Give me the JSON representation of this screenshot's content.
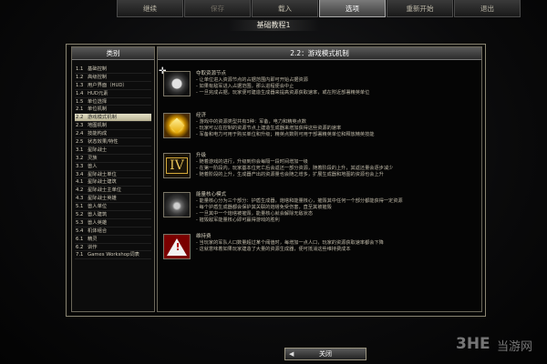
{
  "top_menu": {
    "tabs": [
      {
        "label": "继续",
        "state": "normal"
      },
      {
        "label": "保存",
        "state": "dim"
      },
      {
        "label": "载入",
        "state": "normal"
      },
      {
        "label": "选项",
        "state": "active"
      },
      {
        "label": "重新开始",
        "state": "normal"
      },
      {
        "label": "退出",
        "state": "normal"
      }
    ]
  },
  "page_title": "基础教程1",
  "left_panel": {
    "header": "类别",
    "selected_index": 6,
    "items": [
      {
        "num": "1.1",
        "label": "基础控制"
      },
      {
        "num": "1.2",
        "label": "高级控制"
      },
      {
        "num": "1.3",
        "label": "用户界面（HUD）"
      },
      {
        "num": "1.4",
        "label": "HUD元素"
      },
      {
        "num": "1.5",
        "label": "单位选择"
      },
      {
        "num": "2.1",
        "label": "单位机制"
      },
      {
        "num": "2.2",
        "label": "游戏模式机制"
      },
      {
        "num": "2.3",
        "label": "地图机制"
      },
      {
        "num": "2.4",
        "label": "技能构成"
      },
      {
        "num": "2.5",
        "label": "状态效果/特性"
      },
      {
        "num": "3.1",
        "label": "星际战士"
      },
      {
        "num": "3.2",
        "label": "灵族"
      },
      {
        "num": "3.3",
        "label": "兽人"
      },
      {
        "num": "3.4",
        "label": "星际战士单位"
      },
      {
        "num": "4.1",
        "label": "星际战士建筑"
      },
      {
        "num": "4.2",
        "label": "星际战士主单位"
      },
      {
        "num": "4.3",
        "label": "星际战士英雄"
      },
      {
        "num": "5.1",
        "label": "兽人单位"
      },
      {
        "num": "5.2",
        "label": "兽人建筑"
      },
      {
        "num": "5.3",
        "label": "兽人英雄"
      },
      {
        "num": "5.4",
        "label": "机体组合"
      },
      {
        "num": "6.1",
        "label": "精灵"
      },
      {
        "num": "6.2",
        "label": "训作"
      },
      {
        "num": "7.1",
        "label": "Games Workshop词表"
      }
    ]
  },
  "right_panel": {
    "header": "2.2：游戏模式机制",
    "entries": [
      {
        "icon": "resource-point-icon",
        "title": "夺取资源节点",
        "lines": [
          "- 让单位进入资源节点的占据范围内即可开始占据资源",
          "- 如果有敌军进入占据范围，那么进程便会中止",
          "- 一旦完成占据，玩家便可建造生成器来提高资源获取速率，或在附近部署精英单位"
        ]
      },
      {
        "icon": "economy-icon",
        "title": "经济",
        "lines": [
          "- 游戏中的资源类型共有3种：军备，电力和精英点数",
          "- 玩家可以在控制的资源节点上建造生成器来增加获得这些资源的速率",
          "- 军备和电力可用于购买单位和升级；精英点数则可用于部署精英单位和释放精英技能"
        ]
      },
      {
        "icon": "upgrade-icon",
        "icon_text": "IV",
        "title": "升级",
        "lines": [
          "- 随着游戏的进行，升级到你会每隔一段时间增加一级",
          "- 在第一阶段内，玩家基本位死亡后会返还一部分资源，随着阶段的上升，其返还量会逐步减少",
          "- 随着阶段的上升，生成器产出的资源量也会随之增多，扩展生成器和地图的资源也会上升"
        ]
      },
      {
        "icon": "power-core-icon",
        "title": "能量核心模式",
        "lines": [
          "- 能量核心分为三个部分：护盾生成器，炮塔和能量核心，摧毁其中任何一个部分都能获得一定资源",
          "- 每个护盾生成器都会保护其关联的炮塔免受伤害，直至其被摧毁",
          "- 一旦其中一个炮塔被摧毁，能量核心就会解除无敌状态",
          "- 摧毁敌军能量核心即可赢得游戏的胜利"
        ]
      },
      {
        "icon": "upkeep-warning-icon",
        "title": "维持费",
        "lines": [
          "- 当玩家的军队人口数量超过某个阈值时，每增加一点人口，玩家的资源获取速率都会下降",
          "- 这就意味着如果玩家建造了大量的资源生成器，便可抵消这些维持费成本"
        ]
      }
    ]
  },
  "close_button": {
    "label": "关闭",
    "arrow": "◀"
  },
  "watermark": {
    "logo": "3HE",
    "text": "当游网"
  }
}
